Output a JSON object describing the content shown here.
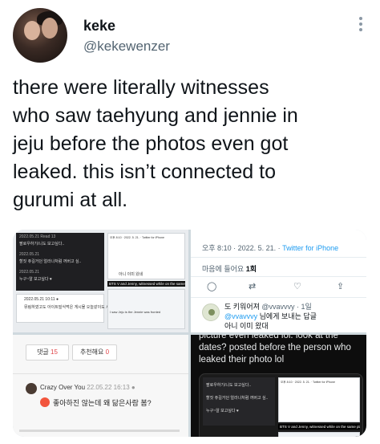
{
  "header": {
    "display_name": "keke",
    "handle": "@kekewenzer"
  },
  "icons": {
    "more": "more-vertical-icon"
  },
  "tweet": {
    "text": "there were literally witnesses\nwho saw taehyung and jennie in\njeju before the photos even got\nleaked. this isn’t connected to\ngurumi at all."
  },
  "media": {
    "tile1": {
      "rows": [
        "2022.05.21 Read 13",
        "팔로우하기/니도 보고싶다..",
        "2022.05.21",
        "할짓 쥬길거던 얼라나처럼 꺼버고 싶..",
        "2022.05.21",
        "누구~알 보고싶다 ♥",
        "2022.05.21 10:11 ●",
        "뮤림하였고도 아이트빌식먹은 게시물 오늘같이도 시티지요"
      ],
      "inner_meta": "오후 8:10 · 2022. 5. 21. · Twitter for iPhone",
      "inner_reply": "아니 이미 왔네",
      "headline": "BTS V and Jenny, witnessed while on the same plane",
      "search_text": "I saw Jeju is the Jennie was fronted"
    },
    "tile2": {
      "time": "오후 8:10 · 2022. 5. 21. · ",
      "source": "Twitter for iPhone",
      "stats_label": "마음에 들어요 ",
      "stats_count": "1회",
      "reply_name": "도 키워어져 ",
      "reply_handle": "@vvavvvy · 1일",
      "reply_to": "@vvavvvy",
      "reply_to_text": " 님에게 보내는 답글",
      "reply_text": "아니 이미 왔대"
    },
    "tile3": {
      "reply_label": "댓글 ",
      "reply_count": "15",
      "recommend_label": "추천해요 ",
      "recommend_count": "0",
      "commenter": "Crazy Over You",
      "comment_date": " 22.05.22 16:13 ●",
      "comment_text": "좋아하진 않는데 왜 닮은사람 봄?"
    },
    "tile4": {
      "text": "picture even leaked lol. look at the\ndates? posted before the person who\nleaked their photo lol"
    }
  }
}
